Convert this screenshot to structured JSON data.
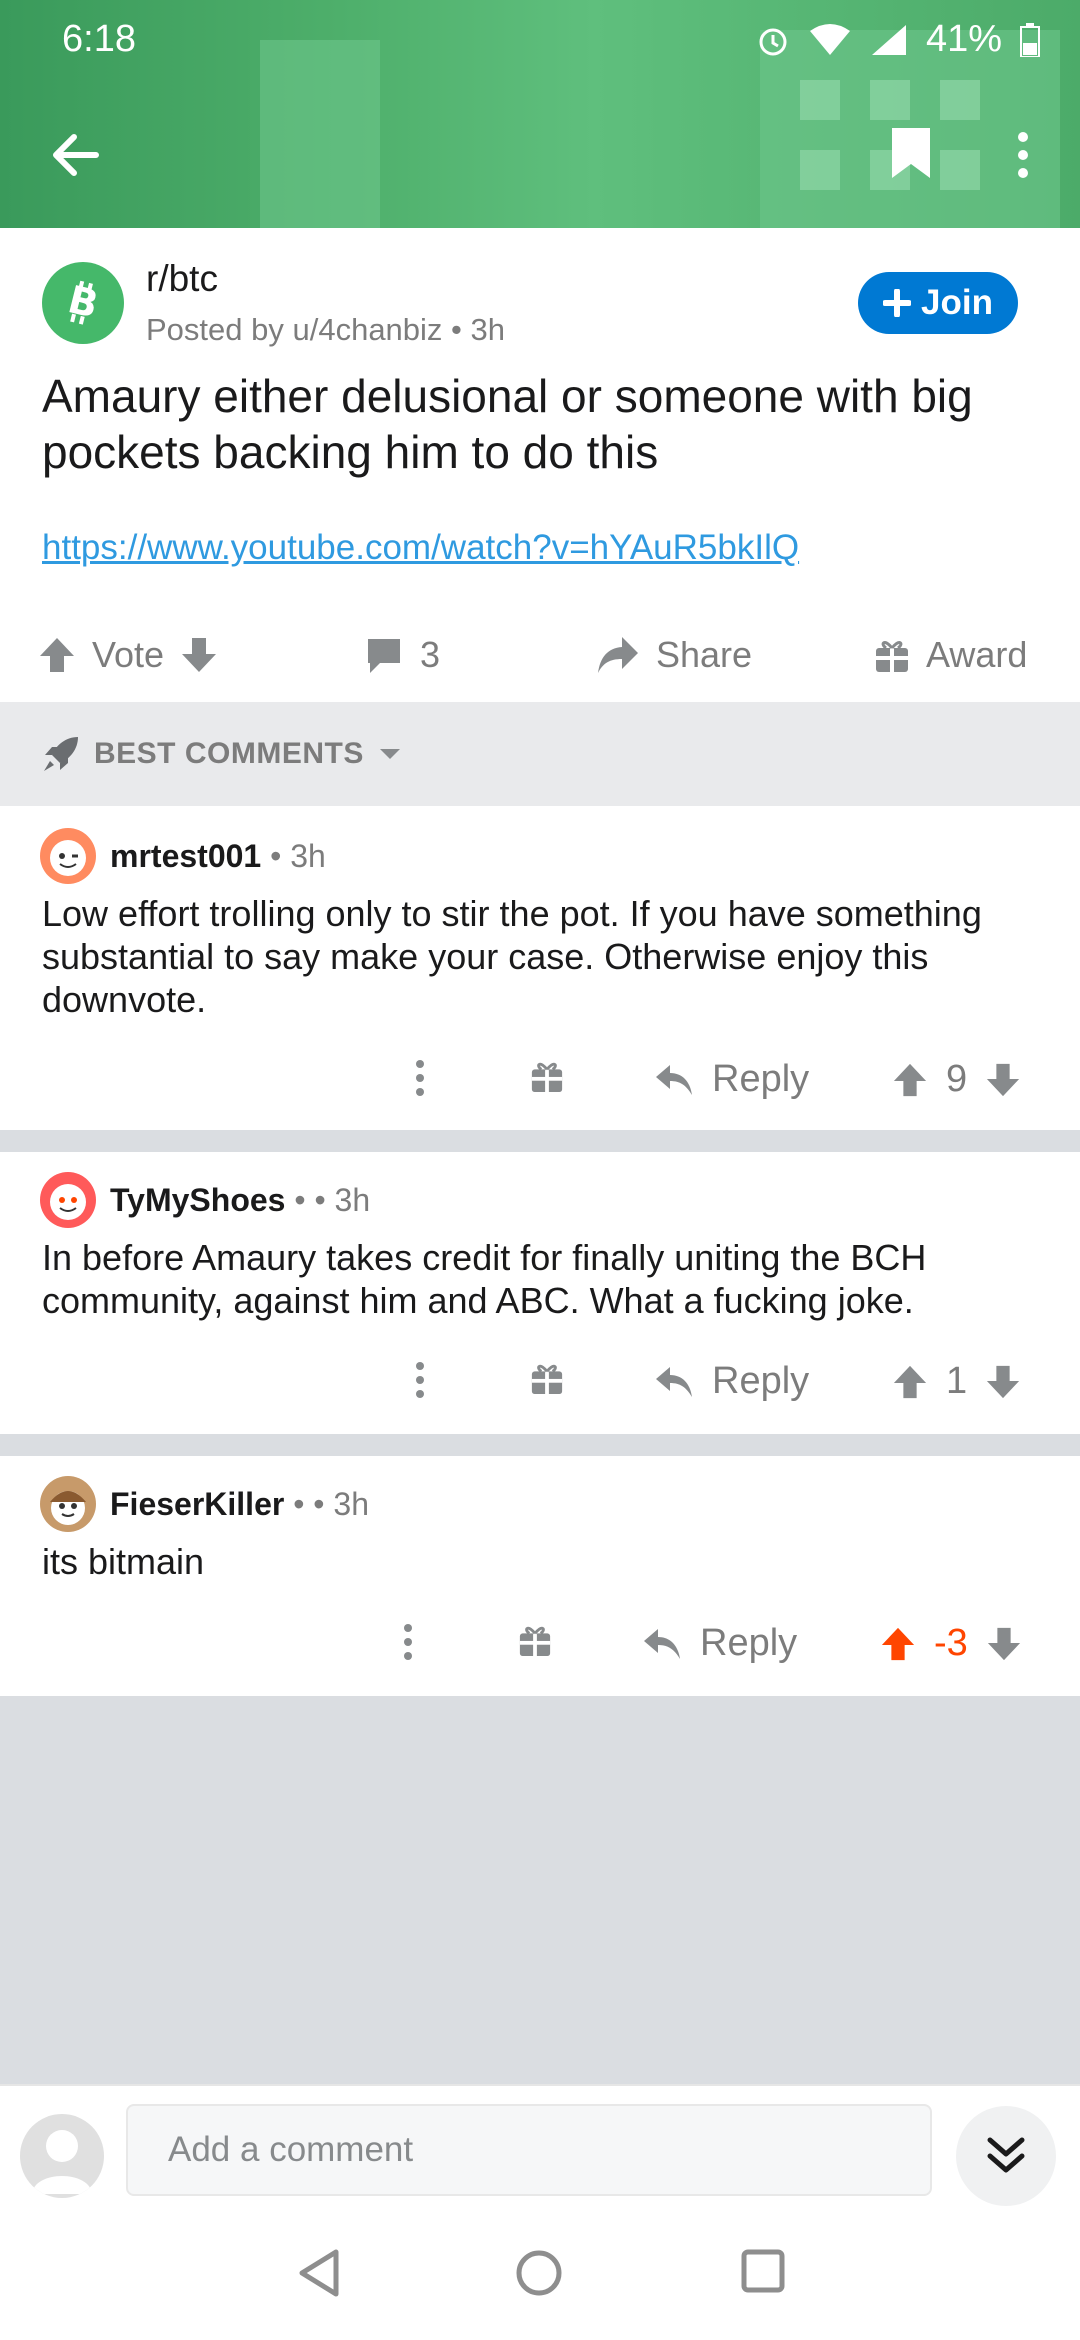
{
  "status_bar": {
    "time": "6:18",
    "battery": "41%"
  },
  "post": {
    "subreddit": "r/btc",
    "posted_by": "Posted by u/4chanbiz • 3h",
    "join_label": "Join",
    "title": "Amaury either delusional or someone with big pockets backing him to do this",
    "link": "https://www.youtube.com/watch?v=hYAuR5bkIlQ",
    "vote_label": "Vote",
    "comment_count": "3",
    "share_label": "Share",
    "award_label": "Award"
  },
  "sort": {
    "label": "BEST COMMENTS"
  },
  "comments": [
    {
      "username": "mrtest001",
      "meta": " • 3h",
      "body": "Low effort trolling only to stir the pot.  If you have something substantial to say make your case.  Otherwise enjoy this downvote.",
      "reply_label": "Reply",
      "score": "9"
    },
    {
      "username": "TyMyShoes",
      "meta": " •  • 3h",
      "body": "In before Amaury takes credit for finally uniting the BCH community, against him and ABC. What a fucking joke.",
      "reply_label": "Reply",
      "score": "1"
    },
    {
      "username": "FieserKiller",
      "meta": " •  • 3h",
      "body": "its bitmain",
      "reply_label": "Reply",
      "score": "-3"
    }
  ],
  "comment_box": {
    "placeholder": "Add a comment"
  },
  "colors": {
    "accent": "#0079d3",
    "link": "#2f9ae0",
    "upvote_active": "#ff4500",
    "sub_icon": "#45b86a"
  }
}
